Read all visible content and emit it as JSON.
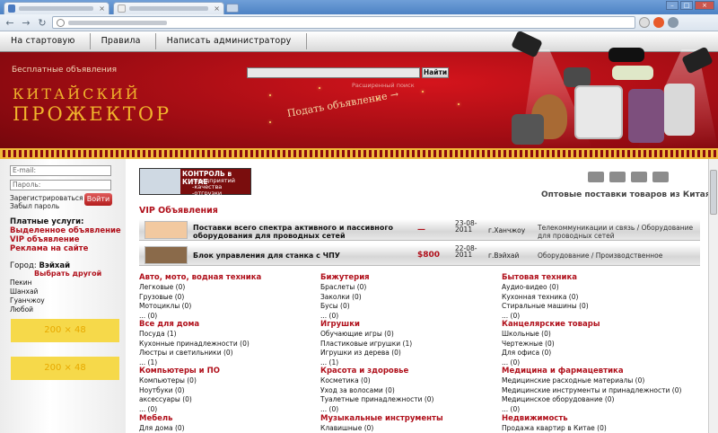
{
  "site": {
    "nav": [
      "На стартовую",
      "Правила",
      "Написать администратору"
    ],
    "free_ads": "Бесплатные объявления",
    "search_button": "Найти",
    "advanced_search": "Расширенный поиск",
    "logo_top": "КИТАЙСКИЙ",
    "logo_bottom": "ПРОЖЕКТОР",
    "post_ad": "Подать объявление →"
  },
  "login": {
    "email_placeholder": "E-mail:",
    "password_placeholder": "Пароль:",
    "register": "Зарегистрироваться",
    "forgot": "Забыл пароль",
    "login_button": "Войти"
  },
  "paid": {
    "title": "Платные услуги:",
    "links": [
      "Выделенное объявление",
      "VIP объявление",
      "Реклама на сайте"
    ]
  },
  "city": {
    "label": "Город:",
    "current": "Вэйхай",
    "choose": "Выбрать другой",
    "list": [
      "Пекин",
      "Шанхай",
      "Гуанчжоу",
      "Любой"
    ]
  },
  "banners": [
    "200 × 48",
    "200 × 48"
  ],
  "promo": {
    "title": "КОНТРОЛЬ в КИТАЕ",
    "lines": [
      "-предприятий",
      "-качества",
      "-отгрузки"
    ]
  },
  "wholesale": "Оптовые поставки товаров из Китая",
  "vip": {
    "title": "VIP Объявления",
    "rows": [
      {
        "title": "Поставки всего спектра активного и пассивного оборудования для проводных сетей",
        "price": "—",
        "date": "23-08-2011",
        "city": "г.Ханчжоу",
        "category": "Телекоммуникации и связь / Оборудование для проводных сетей"
      },
      {
        "title": "Блок управления для станка с ЧПУ",
        "price": "$800",
        "date": "22-08-2011",
        "city": "г.Вэйхай",
        "category": "Оборудование / Производственное"
      }
    ]
  },
  "categories": [
    {
      "title": "Авто, мото, водная техника",
      "items": [
        "Легковые  (0)",
        "Грузовые  (0)",
        "Мотоциклы  (0)",
        "...  (0)"
      ]
    },
    {
      "title": "Бижутерия",
      "items": [
        "Браслеты  (0)",
        "Заколки  (0)",
        "Бусы  (0)",
        "...  (0)"
      ]
    },
    {
      "title": "Бытовая техника",
      "items": [
        "Аудио-видео  (0)",
        "Кухонная техника  (0)",
        "Стиральные машины  (0)",
        "...  (0)"
      ]
    },
    {
      "title": "Все для дома",
      "items": [
        "Посуда  (1)",
        "Кухонные принадлежности  (0)",
        "Люстры и светильники  (0)",
        "...  (1)"
      ]
    },
    {
      "title": "Игрушки",
      "items": [
        "Обучающие игры  (0)",
        "Пластиковые игрушки  (1)",
        "Игрушки из дерева  (0)",
        "...  (1)"
      ]
    },
    {
      "title": "Канцелярские товары",
      "items": [
        "Школьные  (0)",
        "Чертежные  (0)",
        "Для офиса  (0)",
        "...  (0)"
      ]
    },
    {
      "title": "Компьютеры и ПО",
      "items": [
        "Компьютеры  (0)",
        "Ноутбуки  (0)",
        "аксессуары  (0)",
        "...  (0)"
      ]
    },
    {
      "title": "Красота и здоровье",
      "items": [
        "Косметика  (0)",
        "Уход за волосами  (0)",
        "Туалетные принадлежности  (0)",
        "...  (0)"
      ]
    },
    {
      "title": "Медицина и фармацевтика",
      "items": [
        "Медицинские расходные материалы  (0)",
        "Медицинские инструменты и принадлежности  (0)",
        "Медицинское оборудование  (0)",
        "...  (0)"
      ]
    },
    {
      "title": "Мебель",
      "items": [
        "Для дома  (0)"
      ]
    },
    {
      "title": "Музыкальные инструменты",
      "items": [
        "Клавишные  (0)"
      ]
    },
    {
      "title": "Недвижимость",
      "items": [
        "Продажа квартир в Китае  (0)"
      ]
    }
  ],
  "colors": {
    "brand_red": "#b0101b",
    "gold": "#f1b52c",
    "banner_yellow": "#f6d94a"
  }
}
